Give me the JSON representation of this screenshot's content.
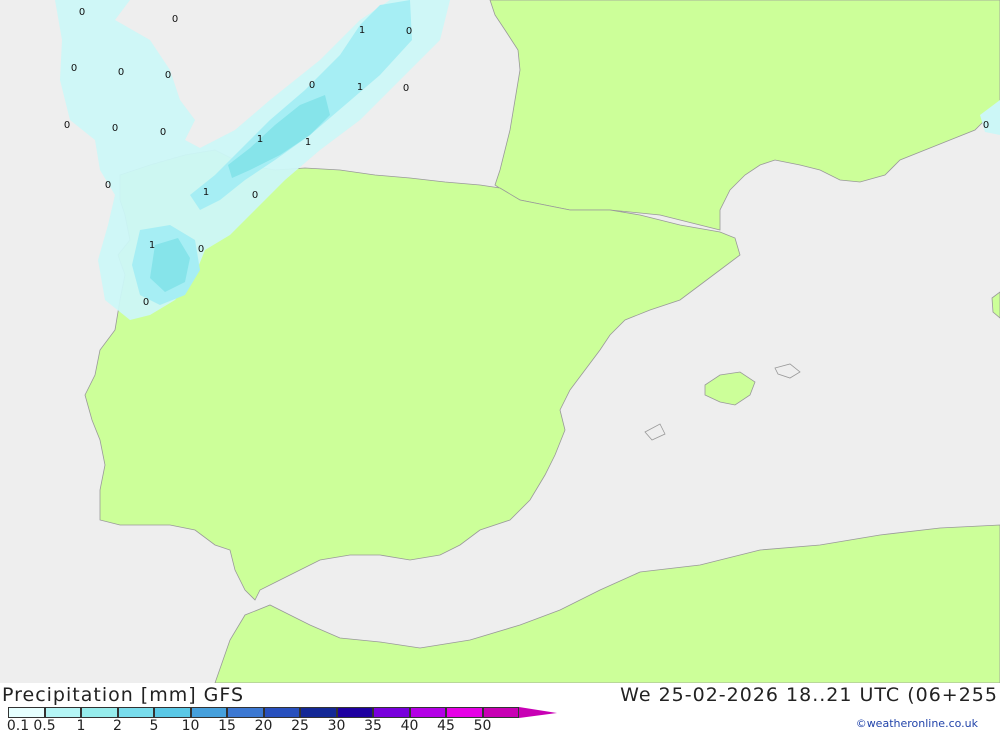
{
  "header": {
    "left_title": "Precipitation [mm] GFS",
    "right_title": "We 25-02-2026 18..21 UTC (06+255"
  },
  "legend": {
    "labels": [
      "0.1",
      "0.5",
      "1",
      "2",
      "5",
      "10",
      "15",
      "20",
      "25",
      "30",
      "35",
      "40",
      "45",
      "50"
    ],
    "colors": [
      "#e6ffff",
      "#b4f5f5",
      "#96ecec",
      "#78dcec",
      "#5ac8e6",
      "#46a0dc",
      "#3c78d2",
      "#2850be",
      "#142896",
      "#1e00a0",
      "#7800dc",
      "#b400e6",
      "#e600e6",
      "#c800b4"
    ]
  },
  "credit": "©weatheronline.co.uk",
  "colors": {
    "sea": "#eeeeee",
    "land": "#ccff99",
    "precip_light": "#ccf7f7",
    "precip_mid": "#a6eef4",
    "precip_heavy": "#86e4ea"
  },
  "map_values": [
    "0",
    "0",
    "0",
    "0",
    "0",
    "0",
    "0",
    "0",
    "1",
    "0",
    "0",
    "1",
    "0",
    "0",
    "0",
    "0",
    "1",
    "1",
    "0",
    "1",
    "0",
    "1",
    "0",
    "0",
    "0"
  ]
}
